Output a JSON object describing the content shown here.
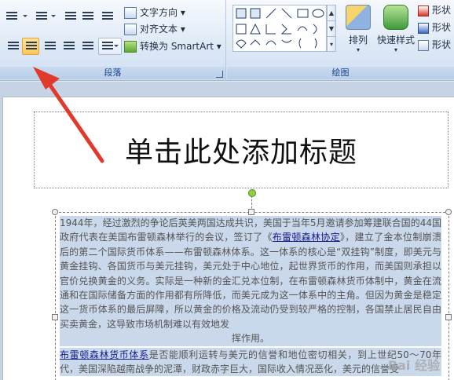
{
  "ribbon": {
    "paragraph_group": {
      "label": "段落",
      "text_direction": "文字方向",
      "align_text": "对齐文本",
      "smartart": "转换为 SmartArt"
    },
    "drawing_group": {
      "label": "绘图",
      "arrange": "排列",
      "quick_styles": "快速样式",
      "shape_fill": "形状",
      "shape_outline": "形状",
      "shape_effects": "形状"
    }
  },
  "slide": {
    "title_placeholder": "单击此处添加标题",
    "body": {
      "p1_part1": "1944年，经过激烈的争论后英美两国达成共识，美国于当年5月邀请参加筹建联合国的44国政府代表在美国布雷顿森林举行的会议，签订了《",
      "p1_link": "布雷顿森林协定",
      "p1_part2": "》，建立了金本位制崩溃后的第二个国际货币体系——布雷顿森林体系。这一体系的核心是“双挂钩”制度，即美元与黄金挂钩、各国货币与美元挂钩，美元处于中心地位，起世界货币的作用，而美国则承担以官价兑换黄金的义务。实际是一种新的金汇兑本位制，在布雷顿森林货币体制中，黄金在流通和在国际储备方面的作用都有所降低，而美元成为这一体系中的主角。但因为黄金是稳定这一货币体系的最后屏障，所以黄金的价格及流动仍受到较严格的控制，各国禁止居民自由买卖黄金，这导致市场机制难以有效地发",
      "p1_last": "挥作用。",
      "p2_link": "布雷顿森林货币体系",
      "p2_text": "是否能顺利运转与美元的信誉和地位密切相关，到上世纪50～70年代，美国深陷越南战争的泥潭，财政赤字巨大，国际收入情况恶化，美元的信誉受"
    }
  },
  "watermark": "Bai 经验"
}
